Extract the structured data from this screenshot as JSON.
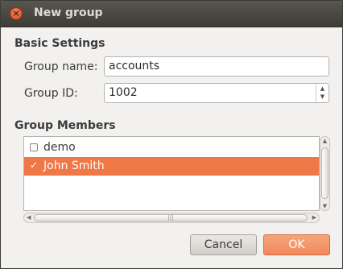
{
  "window": {
    "title": "New group",
    "close_glyph": "×"
  },
  "basic_settings": {
    "heading": "Basic Settings",
    "group_name_label": "Group name:",
    "group_name_value": "accounts",
    "group_id_label": "Group ID:",
    "group_id_value": "1002"
  },
  "members": {
    "heading": "Group Members",
    "items": [
      {
        "name": "demo",
        "checked": false,
        "selected": false
      },
      {
        "name": "John Smith",
        "checked": true,
        "selected": true
      }
    ]
  },
  "buttons": {
    "cancel": "Cancel",
    "ok": "OK"
  },
  "colors": {
    "accent": "#f07746",
    "titlebar": "#4a4943"
  },
  "icons": {
    "close": "close-icon",
    "check": "check-icon",
    "spin_up": "chevron-up-icon",
    "spin_down": "chevron-down-icon"
  }
}
